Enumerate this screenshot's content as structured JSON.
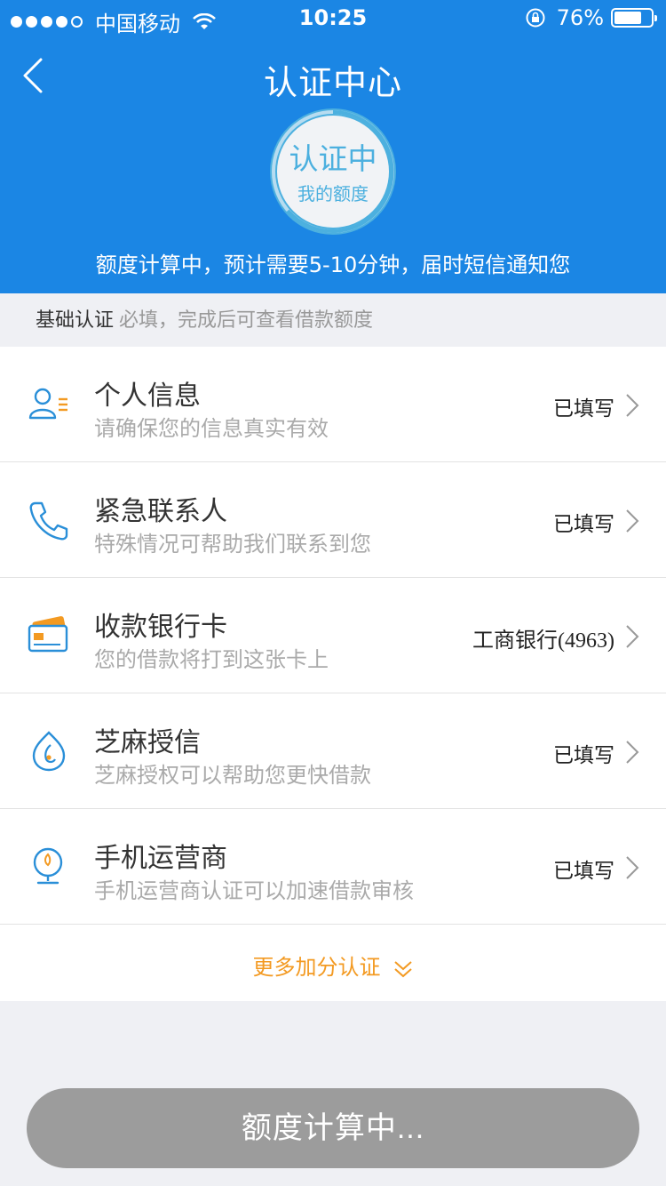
{
  "status_bar": {
    "carrier": "中国移动",
    "time": "10:25",
    "battery": "76%",
    "battery_level": 0.76
  },
  "header": {
    "title": "认证中心",
    "badge_main": "认证中",
    "badge_sub": "我的额度",
    "notice": "额度计算中，预计需要5-10分钟，届时短信通知您"
  },
  "section": {
    "title": "基础认证",
    "subtitle": "必填，完成后可查看借款额度"
  },
  "items": [
    {
      "title": "个人信息",
      "desc": "请确保您的信息真实有效",
      "status": "已填写",
      "icon": "person-info-icon"
    },
    {
      "title": "紧急联系人",
      "desc": "特殊情况可帮助我们联系到您",
      "status": "已填写",
      "icon": "phone-icon"
    },
    {
      "title": "收款银行卡",
      "desc": "您的借款将打到这张卡上",
      "status": "工商银行(4963)",
      "icon": "bank-card-icon"
    },
    {
      "title": "芝麻授信",
      "desc": "芝麻授权可以帮助您更快借款",
      "status": "已填写",
      "icon": "sesame-icon"
    },
    {
      "title": "手机运营商",
      "desc": "手机运营商认证可以加速借款审核",
      "status": "已填写",
      "icon": "carrier-globe-icon"
    }
  ],
  "more": {
    "label": "更多加分认证"
  },
  "bottom_button": {
    "label": "额度计算中..."
  },
  "colors": {
    "header_blue": "#1b86e4",
    "accent_orange": "#f39a22",
    "icon_blue": "#2a8fd8",
    "badge_cyan": "#4cb0df"
  }
}
